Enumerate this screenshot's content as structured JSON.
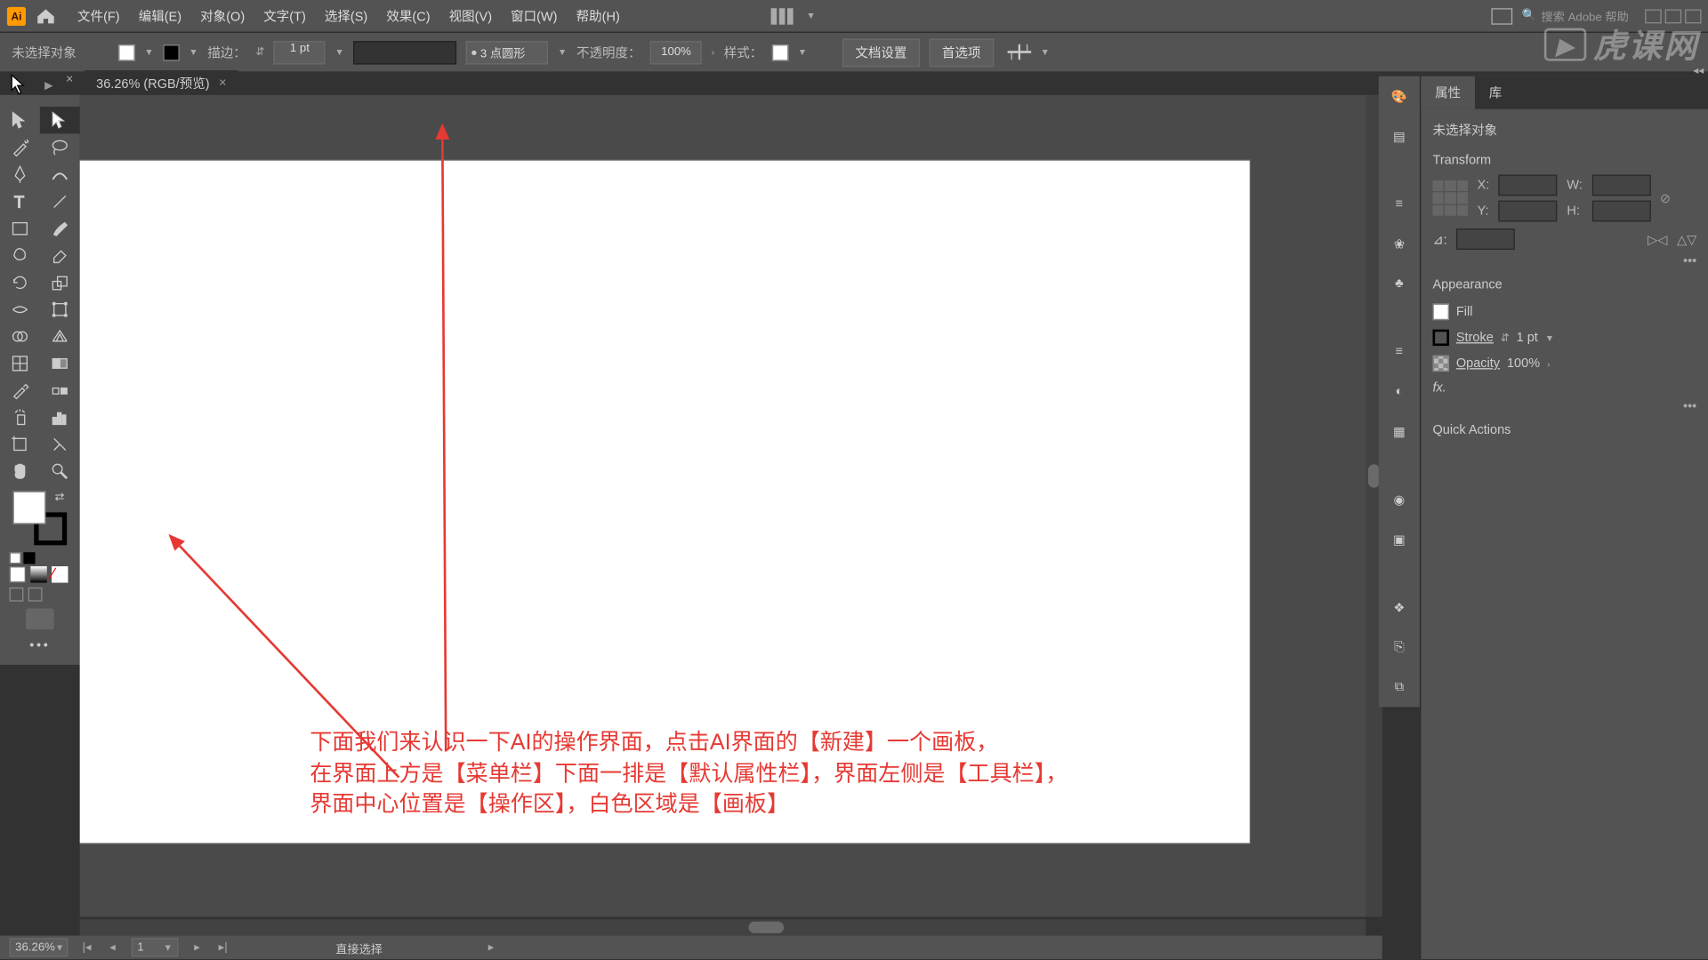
{
  "menu": {
    "items": [
      "文件(F)",
      "编辑(E)",
      "对象(O)",
      "文字(T)",
      "选择(S)",
      "效果(C)",
      "视图(V)",
      "窗口(W)",
      "帮助(H)"
    ],
    "search_placeholder": "搜索 Adobe 帮助"
  },
  "control": {
    "no_selection": "未选择对象",
    "stroke_label": "描边：",
    "stroke_val": "1 pt",
    "point_style": "3 点圆形",
    "opacity_label": "不透明度：",
    "opacity_val": "100%",
    "style_label": "样式：",
    "doc_setup": "文档设置",
    "prefs": "首选项"
  },
  "doc_tab": {
    "title": "36.26% (RGB/预览)"
  },
  "properties": {
    "tab_properties": "属性",
    "tab_library": "库",
    "no_selection": "未选择对象",
    "transform_title": "Transform",
    "labels": {
      "x": "X:",
      "y": "Y:",
      "w": "W:",
      "h": "H:",
      "angle": "⊿:"
    },
    "appearance_title": "Appearance",
    "fill_label": "Fill",
    "stroke_label": "Stroke",
    "stroke_val": "1 pt",
    "opacity_label": "Opacity",
    "opacity_val": "100%",
    "fx": "fx.",
    "quick_actions": "Quick Actions"
  },
  "status": {
    "zoom": "36.26%",
    "artboard_num": "1",
    "tool_hint": "直接选择"
  },
  "annotations": {
    "line1": "下面我们来认识一下AI的操作界面，点击AI界面的【新建】一个画板，",
    "line2": "在界面上方是【菜单栏】下面一排是【默认属性栏】，界面左侧是【工具栏】，",
    "line3": "界面中心位置是【操作区】，白色区域是【画板】"
  },
  "watermark": "虎课网"
}
